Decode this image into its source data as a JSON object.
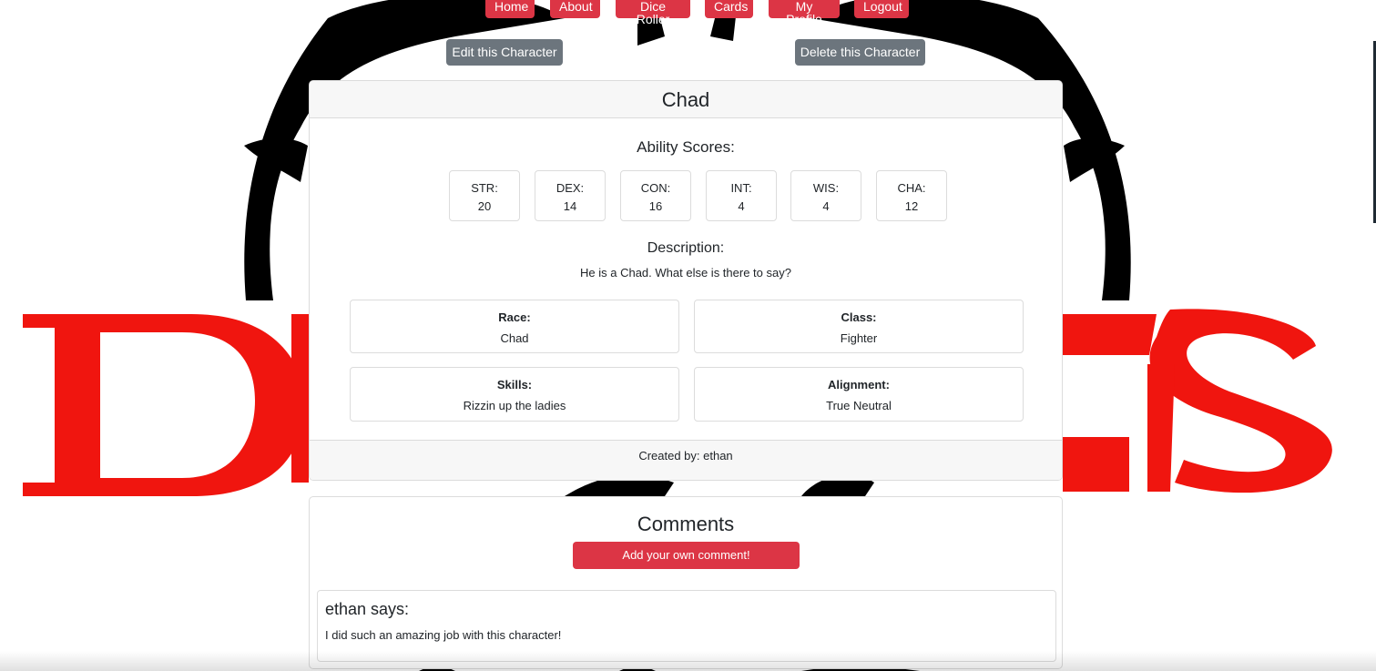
{
  "nav": {
    "home": "Home",
    "about": "About",
    "dice_roller": "Dice Roller",
    "cards": "Cards",
    "my_profile": "My Profile",
    "logout": "Logout"
  },
  "actions": {
    "edit": "Edit this Character",
    "delete": "Delete this Character"
  },
  "character": {
    "name": "Chad",
    "ability_title": "Ability Scores:",
    "abilities": [
      {
        "label": "STR:",
        "value": "20"
      },
      {
        "label": "DEX:",
        "value": "14"
      },
      {
        "label": "CON:",
        "value": "16"
      },
      {
        "label": "INT:",
        "value": "4"
      },
      {
        "label": "WIS:",
        "value": "4"
      },
      {
        "label": "CHA:",
        "value": "12"
      }
    ],
    "description_title": "Description:",
    "description": "He is a Chad. What else is there to say?",
    "race_label": "Race:",
    "race": "Chad",
    "class_label": "Class:",
    "class": "Fighter",
    "skills_label": "Skills:",
    "skills": "Rizzin up the ladies",
    "alignment_label": "Alignment:",
    "alignment": "True Neutral",
    "created_by": "Created by: ethan"
  },
  "comments": {
    "title": "Comments",
    "add_button": "Add your own comment!",
    "items": [
      {
        "author": "ethan says:",
        "text": "I did such an amazing job with this character!"
      }
    ]
  },
  "colors": {
    "accent": "#dc3545",
    "secondary": "#6c757d",
    "logo_red": "#f0150f",
    "logo_black": "#000000"
  }
}
